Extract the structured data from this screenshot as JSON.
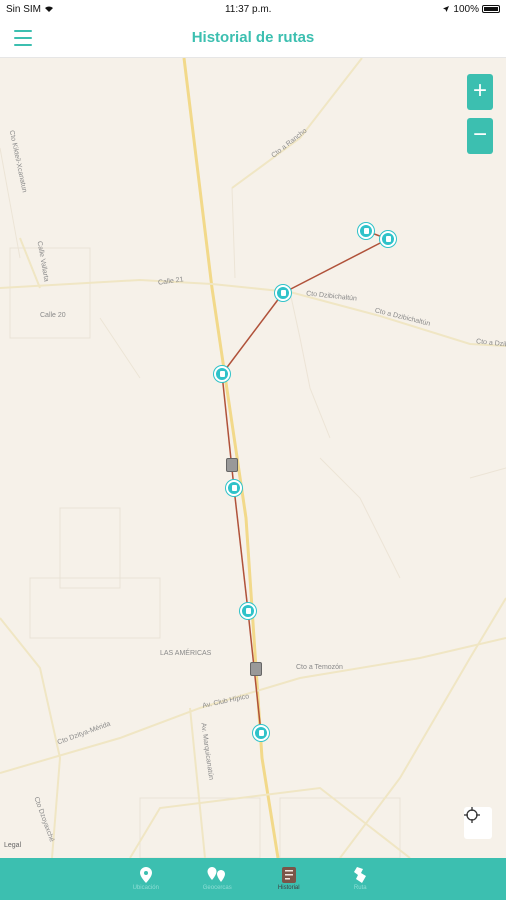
{
  "status": {
    "carrier": "Sin SIM",
    "time": "11:37 p.m.",
    "battery": "100%"
  },
  "header": {
    "title": "Historial de rutas"
  },
  "map": {
    "zoom_in": "+",
    "zoom_out": "−",
    "legal": "Legal",
    "labels": {
      "cto_rancho": "Cto a Rancho",
      "calle_21": "Calle 21",
      "calle_20": "Calle 20",
      "cto_dzibichaltun": "Cto Dzibichaltún",
      "cto_a_dzibichaltun": "Cto a Dzibichaltún",
      "cto_a_dzibi": "Cto a Dzibi",
      "las_americas": "LAS AMÉRICAS",
      "cto_a_temozon": "Cto a Temozón",
      "av_club_hipico": "Av. Club Hípico",
      "cto_dzityamerida": "Cto Dzitya-Mérida",
      "av_xcanatun": "Av. Marquicanatún",
      "cto_dzoyaxche": "Cto Dzoyaxché",
      "calle_v": "Calle Vallarta",
      "cto_ktsi": "Cto Kikteil-Xcanatun"
    }
  },
  "nav": {
    "tabs": [
      {
        "label": "Ubicación",
        "icon": "map-pin-icon",
        "active": false
      },
      {
        "label": "Geocercas",
        "icon": "map-pins-icon",
        "active": false
      },
      {
        "label": "Historial",
        "icon": "history-icon",
        "active": true
      },
      {
        "label": "Ruta",
        "icon": "route-icon",
        "active": false
      }
    ]
  },
  "colors": {
    "accent": "#3cbfb0",
    "route": "#b0523a",
    "pin": "#2fc2c9"
  }
}
